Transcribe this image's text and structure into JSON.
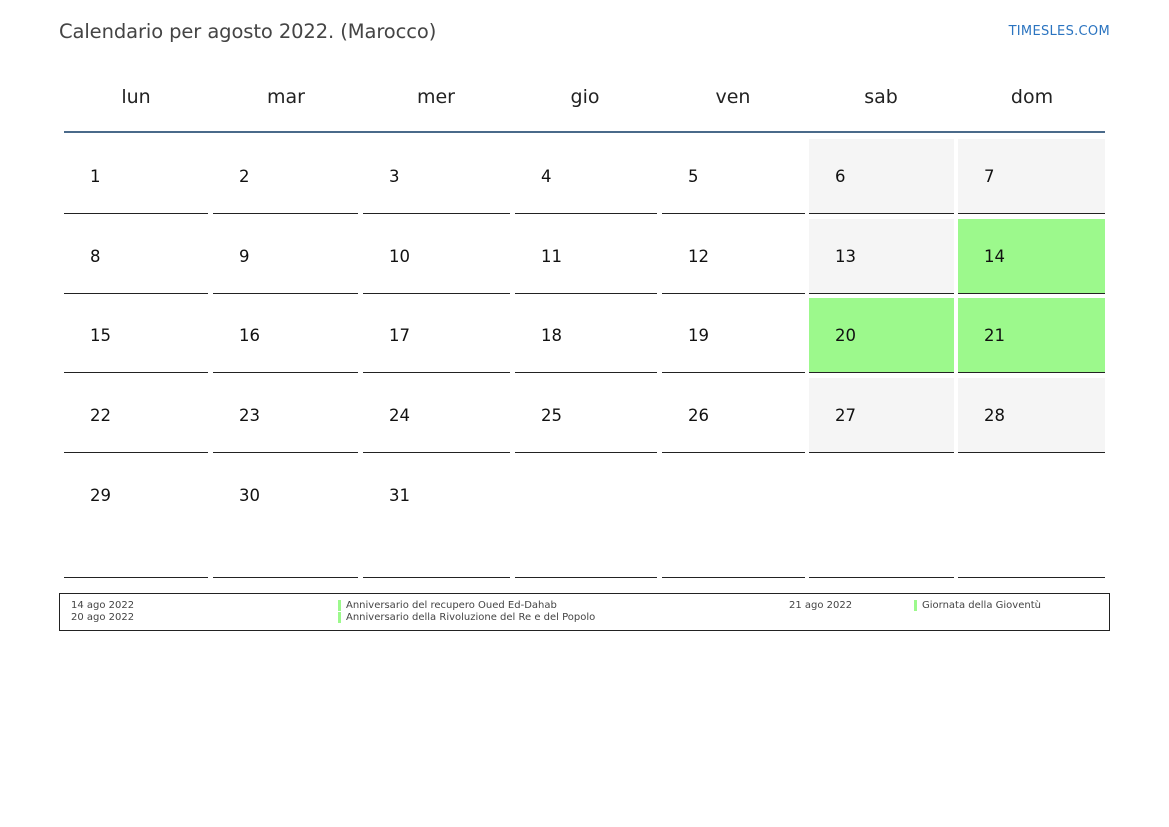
{
  "header": {
    "title": "Calendario per agosto 2022. (Marocco)",
    "brand": "TIMESLES.COM"
  },
  "calendar": {
    "weekdays": [
      "lun",
      "mar",
      "mer",
      "gio",
      "ven",
      "sab",
      "dom"
    ],
    "weeks": [
      [
        "1",
        "2",
        "3",
        "4",
        "5",
        "6",
        "7"
      ],
      [
        "8",
        "9",
        "10",
        "11",
        "12",
        "13",
        "14"
      ],
      [
        "15",
        "16",
        "17",
        "18",
        "19",
        "20",
        "21"
      ],
      [
        "22",
        "23",
        "24",
        "25",
        "26",
        "27",
        "28"
      ],
      [
        "29",
        "30",
        "31",
        "",
        "",
        "",
        ""
      ]
    ],
    "holidays": [
      "14",
      "20",
      "21"
    ],
    "colors": {
      "holiday": "#9cf98c",
      "weekend": "#f5f5f5",
      "header_rule": "#4a6a8a",
      "brand": "#2b74c0"
    }
  },
  "legend": {
    "entries": [
      {
        "date": "14 ago 2022",
        "name": "Anniversario del recupero Oued Ed-Dahab"
      },
      {
        "date": "21 ago 2022",
        "name": "Giornata della Gioventù"
      },
      {
        "date": "20 ago 2022",
        "name": "Anniversario della Rivoluzione del Re e del Popolo"
      }
    ]
  }
}
